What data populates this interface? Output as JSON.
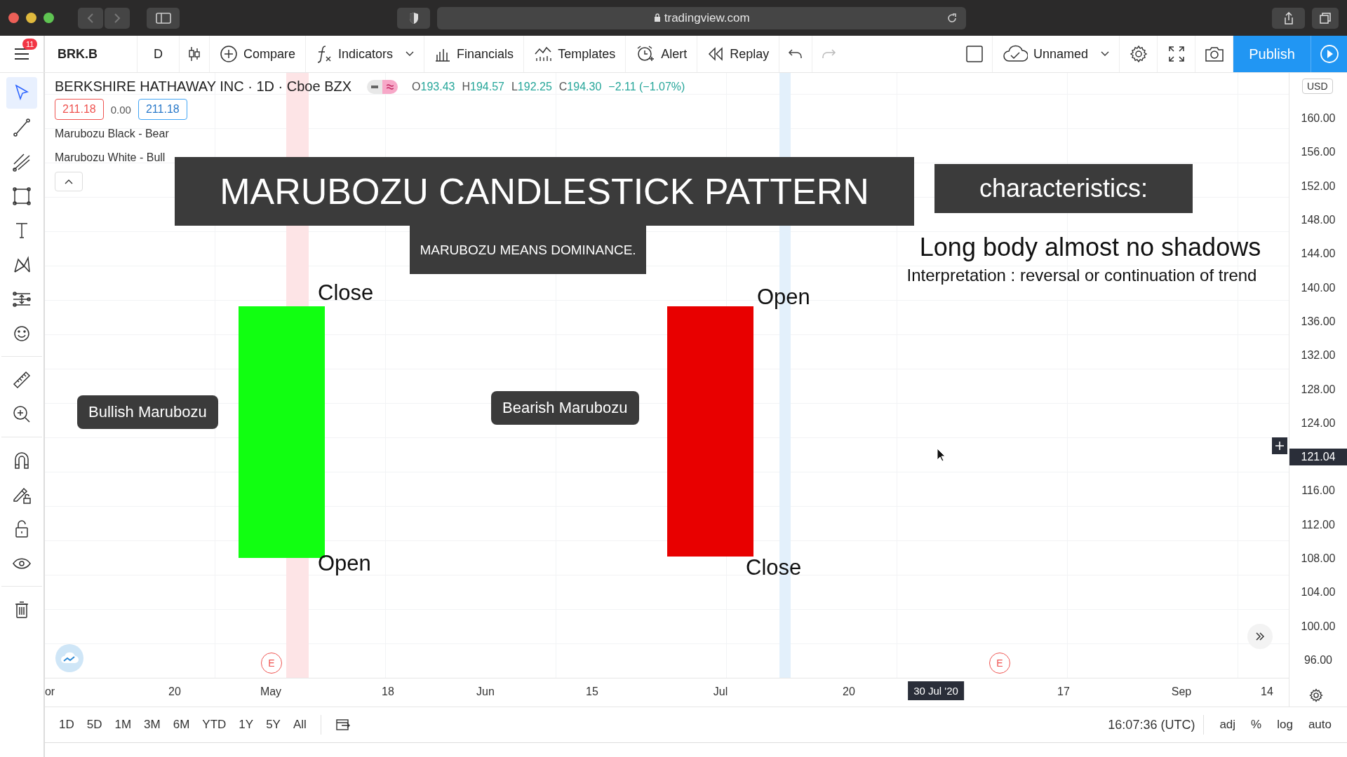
{
  "browser": {
    "url": "tradingview.com"
  },
  "toolbar": {
    "menu_badge": "11",
    "symbol": "BRK.B",
    "interval": "D",
    "buttons": [
      {
        "kind": "compare",
        "label": "Compare"
      },
      {
        "kind": "indicators",
        "label": "Indicators"
      },
      {
        "kind": "financials",
        "label": "Financials"
      },
      {
        "kind": "templates",
        "label": "Templates"
      },
      {
        "kind": "alert",
        "label": "Alert"
      },
      {
        "kind": "replay",
        "label": "Replay"
      }
    ],
    "layout_name": "Unnamed",
    "publish": "Publish"
  },
  "drawing_tools": [
    {
      "kind": "cursor",
      "selected": true
    },
    {
      "kind": "line",
      "selected": false
    },
    {
      "kind": "pitchfork",
      "selected": false
    },
    {
      "kind": "rectangle",
      "selected": false
    },
    {
      "kind": "text",
      "selected": false
    },
    {
      "kind": "pattern",
      "selected": false
    },
    {
      "kind": "sliders",
      "selected": false
    },
    {
      "kind": "emoji",
      "selected": false
    },
    {
      "kind": "ruler",
      "selected": false
    },
    {
      "kind": "zoom",
      "selected": false
    },
    {
      "kind": "magnet",
      "selected": false
    },
    {
      "kind": "pencil-lock",
      "selected": false
    },
    {
      "kind": "lock",
      "selected": false
    },
    {
      "kind": "eye",
      "selected": false
    },
    {
      "kind": "trash",
      "selected": false
    }
  ],
  "legend": {
    "title": "BERKSHIRE HATHAWAY INC · 1D · Cboe BZX",
    "ohlc": [
      {
        "label": "O",
        "value": "193.43"
      },
      {
        "label": "H",
        "value": "194.57"
      },
      {
        "label": "L",
        "value": "192.25"
      },
      {
        "label": "C",
        "value": "194.30"
      }
    ],
    "change": "−2.11 (−1.07%)",
    "bid": "211.18",
    "spread": "0.00",
    "ask": "211.18",
    "indicators": [
      "Marubozu Black - Bear",
      "Marubozu White - Bull"
    ]
  },
  "annotations": {
    "title": "MARUBOZU CANDLESTICK PATTERN",
    "subtitle": "MARUBOZU MEANS DOMINANCE.",
    "characteristics": "characteristics:",
    "heading": "Long body almost no shadows",
    "interpretation": "Interpretation : reversal or continuation of trend",
    "candles": [
      {
        "kind": "bullish",
        "callout": "Bullish Marubozu",
        "top_label": "Close",
        "bottom_label": "Open"
      },
      {
        "kind": "bearish",
        "callout": "Bearish Marubozu",
        "top_label": "Open",
        "bottom_label": "Close"
      }
    ],
    "earnings": [
      "E",
      "E"
    ]
  },
  "price_axis": {
    "currency": "USD",
    "labels": [
      {
        "text": "160.00",
        "kind": "tick"
      },
      {
        "text": "156.00",
        "kind": "tick"
      },
      {
        "text": "152.00",
        "kind": "tick"
      },
      {
        "text": "148.00",
        "kind": "tick"
      },
      {
        "text": "144.00",
        "kind": "tick"
      },
      {
        "text": "140.00",
        "kind": "tick"
      },
      {
        "text": "136.00",
        "kind": "tick"
      },
      {
        "text": "132.00",
        "kind": "tick"
      },
      {
        "text": "128.00",
        "kind": "tick"
      },
      {
        "text": "124.00",
        "kind": "tick"
      },
      {
        "text": "121.04",
        "kind": "crosshair"
      },
      {
        "text": "116.00",
        "kind": "tick"
      },
      {
        "text": "112.00",
        "kind": "tick"
      },
      {
        "text": "108.00",
        "kind": "tick"
      },
      {
        "text": "104.00",
        "kind": "tick"
      },
      {
        "text": "100.00",
        "kind": "tick"
      },
      {
        "text": "96.00",
        "kind": "tick"
      }
    ]
  },
  "time_axis": {
    "labels": [
      {
        "text": "or",
        "kind": "tick"
      },
      {
        "text": "20",
        "kind": "tick"
      },
      {
        "text": "May",
        "kind": "tick"
      },
      {
        "text": "18",
        "kind": "tick"
      },
      {
        "text": "Jun",
        "kind": "tick"
      },
      {
        "text": "15",
        "kind": "tick"
      },
      {
        "text": "Jul",
        "kind": "tick"
      },
      {
        "text": "20",
        "kind": "tick"
      },
      {
        "text": "30 Jul '20",
        "kind": "crosshair"
      },
      {
        "text": "17",
        "kind": "tick"
      },
      {
        "text": "Sep",
        "kind": "tick"
      },
      {
        "text": "14",
        "kind": "tick"
      }
    ]
  },
  "bottom_bar": {
    "periods": [
      "1D",
      "5D",
      "1M",
      "3M",
      "6M",
      "YTD",
      "1Y",
      "5Y",
      "All"
    ],
    "time": "16:07:36 (UTC)",
    "options": [
      "adj",
      "%",
      "log",
      "auto"
    ]
  }
}
